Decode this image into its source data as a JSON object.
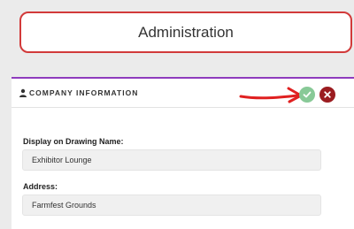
{
  "header": {
    "admin_label": "Administration"
  },
  "card": {
    "title": "COMPANY INFORMATION",
    "title_icon": "person-icon",
    "accent_color": "#8e3bbd",
    "confirm_icon": "check-icon",
    "confirm_color": "#88c997",
    "cancel_icon": "close-icon",
    "cancel_color": "#9b1c20",
    "annotation_arrow_color": "#e02020"
  },
  "fields": {
    "display_name": {
      "label": "Display on Drawing Name:",
      "value": "Exhibitor Lounge"
    },
    "address": {
      "label": "Address:",
      "value": "Farmfest Grounds"
    }
  }
}
